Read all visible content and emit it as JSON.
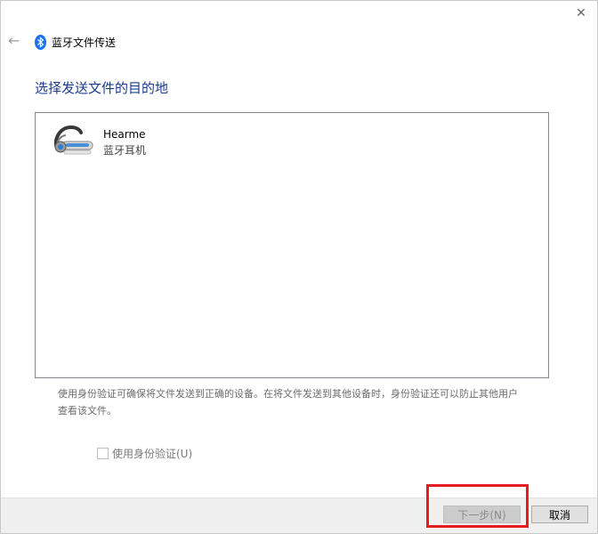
{
  "window": {
    "close_glyph": "✕",
    "back_glyph": "←"
  },
  "header": {
    "title": "蓝牙文件传送",
    "icon": "bluetooth-icon",
    "accent": "#1a73e8"
  },
  "main": {
    "heading": "选择发送文件的目的地",
    "heading_color": "#1a3b8c",
    "devices": [
      {
        "name": "Hearme",
        "type": "蓝牙耳机",
        "icon": "headset-icon"
      }
    ],
    "info": "使用身份验证可确保将文件发送到正确的设备。在将文件发送到其他设备时，身份验证还可以防止其他用户查看该文件。",
    "auth_label": "使用身份验证(U)",
    "auth_checked": false
  },
  "footer": {
    "next_label": "下一步(N)",
    "cancel_label": "取消",
    "highlight_color": "#e51c23"
  }
}
